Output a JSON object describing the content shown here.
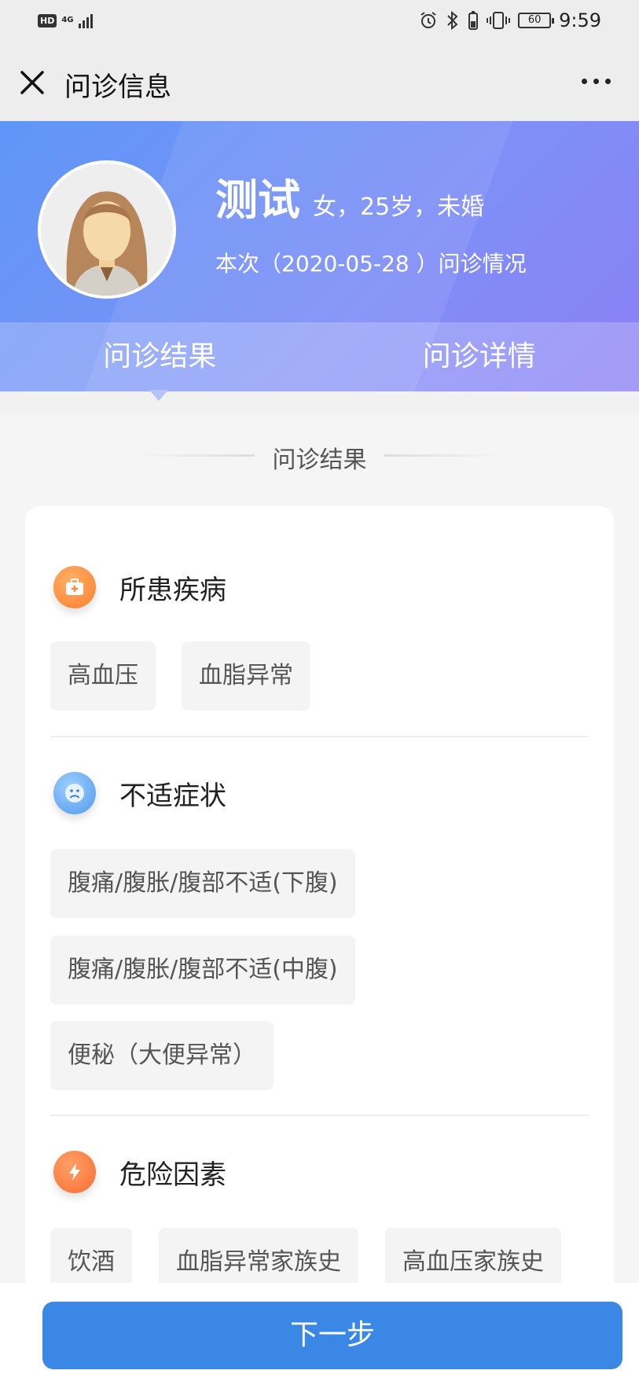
{
  "status_bar": {
    "hd": "HD",
    "network": "4G",
    "battery": "60",
    "time": "9:59"
  },
  "nav": {
    "title": "问诊信息",
    "close_icon": "close-icon",
    "more_icon": "more-dots-icon"
  },
  "profile": {
    "name": "测试",
    "meta": "女，25岁，未婚",
    "visit": "本次（2020-05-28 ）问诊情况"
  },
  "tabs": [
    {
      "label": "问诊结果",
      "active": true
    },
    {
      "label": "问诊详情",
      "active": false
    }
  ],
  "section_title": "问诊结果",
  "groups": [
    {
      "label": "所患疾病",
      "icon": "medical-kit-icon",
      "color": "#fb8a3c",
      "tags": [
        "高血压",
        "血脂异常"
      ]
    },
    {
      "label": "不适症状",
      "icon": "sad-face-icon",
      "color": "#5aa2ee",
      "tags": [
        "腹痛/腹胀/腹部不适(下腹)",
        "腹痛/腹胀/腹部不适(中腹)",
        "便秘（大便异常）"
      ]
    },
    {
      "label": "危险因素",
      "icon": "lightning-icon",
      "color": "#fb7a3a",
      "tags": [
        "饮酒",
        "血脂异常家族史",
        "高血压家族史"
      ]
    }
  ],
  "next_button": "下一步"
}
